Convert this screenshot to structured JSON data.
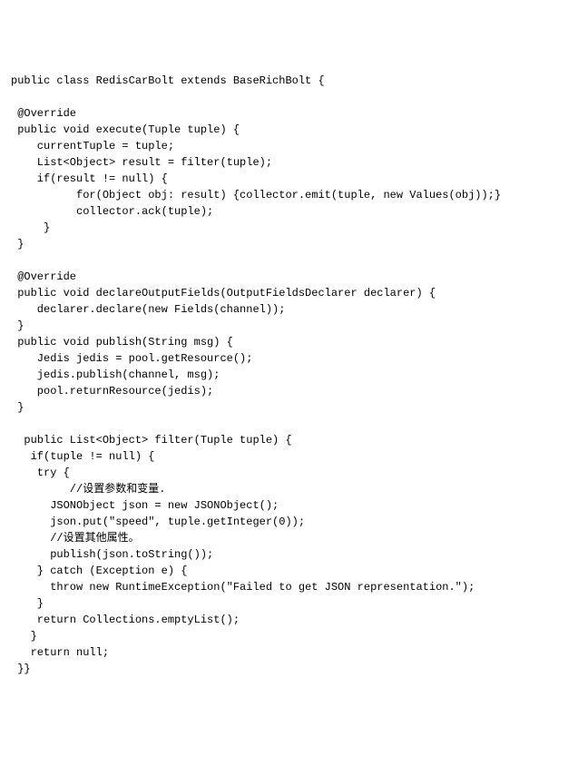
{
  "code": {
    "lines": [
      "public class RedisCarBolt extends BaseRichBolt {",
      "",
      " @Override",
      " public void execute(Tuple tuple) {",
      "    currentTuple = tuple;",
      "    List<Object> result = filter(tuple);",
      "    if(result != null) {",
      "          for(Object obj: result) {collector.emit(tuple, new Values(obj));}",
      "          collector.ack(tuple);",
      "     }",
      " }",
      "",
      " @Override",
      " public void declareOutputFields(OutputFieldsDeclarer declarer) {",
      "    declarer.declare(new Fields(channel));",
      " }",
      " public void publish(String msg) {",
      "    Jedis jedis = pool.getResource();",
      "    jedis.publish(channel, msg);",
      "    pool.returnResource(jedis);",
      " }",
      "",
      "  public List<Object> filter(Tuple tuple) {",
      "   if(tuple != null) {",
      "    try {",
      "         //设置参数和变量.",
      "      JSONObject json = new JSONObject();",
      "      json.put(\"speed\", tuple.getInteger(0));",
      "      //设置其他属性。",
      "      publish(json.toString());",
      "    } catch (Exception e) {",
      "      throw new RuntimeException(\"Failed to get JSON representation.\");",
      "    }",
      "    return Collections.emptyList();",
      "   }",
      "   return null;",
      " }}"
    ]
  }
}
